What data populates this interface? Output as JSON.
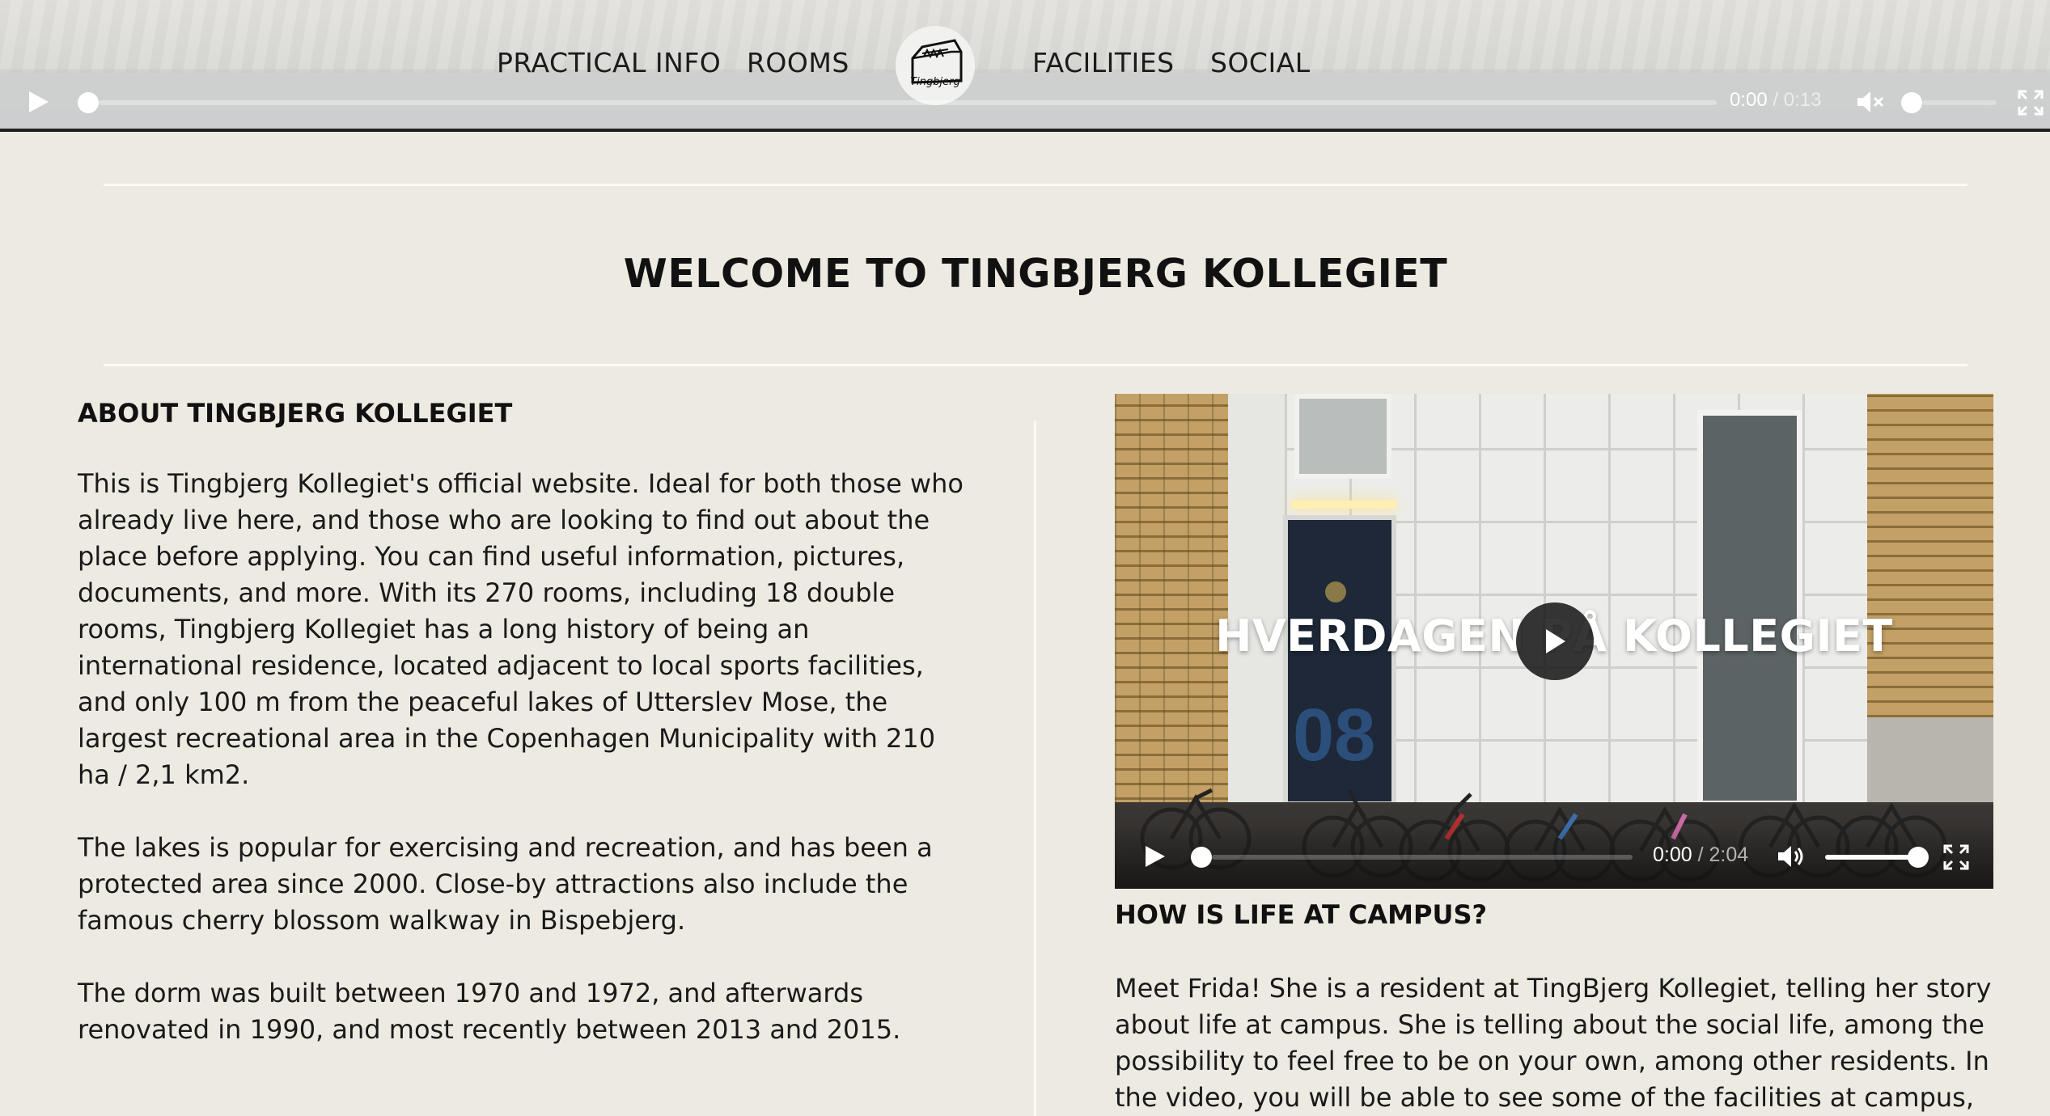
{
  "nav": {
    "practical_info": "PRACTICAL INFO",
    "rooms": "ROOMS",
    "logo_text": "Tingbjerg",
    "facilities": "FACILITIES",
    "social": "SOCIAL"
  },
  "header_video": {
    "current_time": "0:00",
    "duration": "/ 0:13",
    "muted": true,
    "progress": 0,
    "volume": 0
  },
  "main": {
    "title": "WELCOME TO TINGBJERG KOLLEGIET",
    "about": {
      "heading": "ABOUT TINGBJERG KOLLEGIET",
      "paragraphs": [
        "This is Tingbjerg Kollegiet's official website. Ideal for both those who already live here, and those who are looking to find out about the place before applying. You can find useful information, pictures, documents, and more. With its 270 rooms, including 18 double rooms, Tingbjerg Kollegiet has a long history of being an international residence, located adjacent to local sports facilities, and only 100 m from the peaceful lakes of Utterslev Mose, the largest recreational area in the Copenhagen Municipality with 210 ha / 2,1 km2.",
        "The lakes is popular for exercising and recreation, and has been a protected area since 2000. Close-by attractions also include the famous cherry blossom walkway in Bispebjerg.",
        "The dorm was built between 1970 and 1972, and afterwards renovated in 1990, and most recently between 2013 and 2015."
      ]
    },
    "video": {
      "overlay_title": "HVERDAGEN PÅ KOLLEGIET",
      "door_number": "08",
      "current_time": "0:00",
      "duration": "/ 2:04",
      "progress": 0,
      "volume": 1
    },
    "campus": {
      "heading": "HOW IS LIFE AT CAMPUS?",
      "text": "Meet Frida! She is a resident at TingBjerg Kollegiet, telling her story about life at campus. She is telling about the social life, among the possibility to feel free to be on your own, among other residents. In the video, you will be able to see some of the facilities at campus, the lake and the rooms, you"
    }
  }
}
